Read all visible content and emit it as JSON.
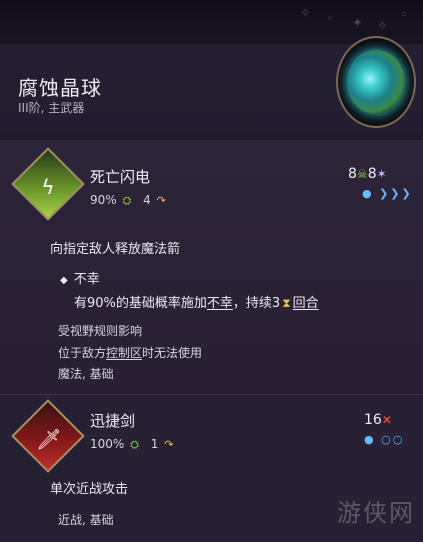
{
  "item": {
    "title": "腐蚀晶球",
    "subtitle": "III阶, 主武器"
  },
  "skill1": {
    "name": "死亡闪电",
    "accuracy": "90%",
    "ap_cost": "4",
    "cooldown": "8",
    "range": "8",
    "range_icon_desc": "purple-range-icon",
    "slot_dots": "● ❯❯❯",
    "description": "向指定敌人释放魔法箭",
    "effect_title": "不幸",
    "effect_line_prefix": "有90%的基础概率施加",
    "effect_term": "不幸",
    "effect_line_mid": "，持续3",
    "effect_duration_term": "回合",
    "note1": "受视野规则影响",
    "note2_prefix": "位于敌方",
    "note2_term": "控制区",
    "note2_suffix": "时无法使用",
    "tags": "魔法, 基础"
  },
  "skill2": {
    "name": "迅捷剑",
    "accuracy": "100%",
    "ap_cost": "1",
    "damage": "16",
    "slot_dots": "● ○○",
    "description": "单次近战攻击",
    "tags": "近战, 基础"
  },
  "watermark": "游侠网",
  "colors": {
    "accent_green": "#8fd14a",
    "accent_gold": "#e6c15a",
    "accent_blue": "#6ab8ff",
    "accent_red": "#ff5a3a"
  }
}
